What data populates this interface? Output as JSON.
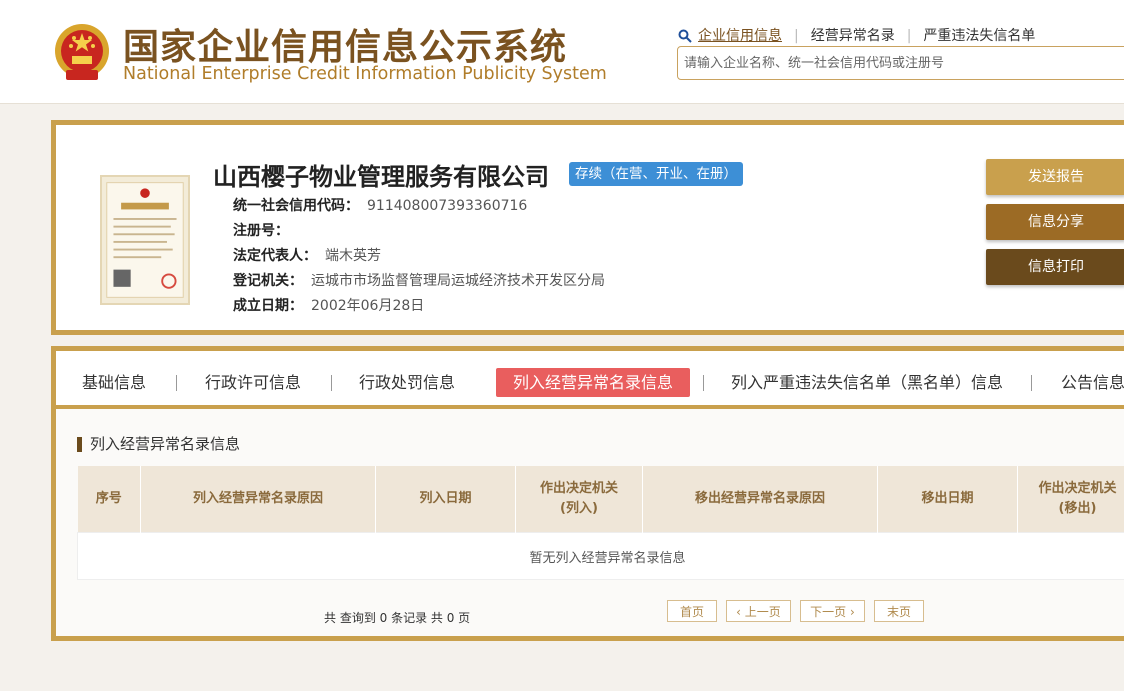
{
  "header": {
    "title_cn": "国家企业信用信息公示系统",
    "title_en": "National Enterprise Credit Information Publicity System",
    "nav": [
      {
        "label": "企业信用信息"
      },
      {
        "label": "经营异常名录"
      },
      {
        "label": "严重违法失信名单"
      }
    ],
    "search": {
      "placeholder": "请输入企业名称、统一社会信用代码或注册号",
      "value": ""
    }
  },
  "company": {
    "name": "山西樱子物业管理服务有限公司",
    "status": "存续（在营、开业、在册）",
    "fields": [
      {
        "label": "统一社会信用代码：",
        "value": "911408007393360716"
      },
      {
        "label": "注册号：",
        "value": ""
      },
      {
        "label": "法定代表人：",
        "value": "端木英芳"
      },
      {
        "label": "登记机关：",
        "value": "运城市市场监督管理局运城经济技术开发区分局"
      },
      {
        "label": "成立日期：",
        "value": "2002年06月28日"
      }
    ],
    "actions": {
      "report": "发送报告",
      "share": "信息分享",
      "print": "信息打印"
    }
  },
  "tabs": [
    {
      "label": "基础信息"
    },
    {
      "label": "行政许可信息"
    },
    {
      "label": "行政处罚信息"
    },
    {
      "label": "列入经营异常名录信息",
      "active": true
    },
    {
      "label": "列入严重违法失信名单（黑名单）信息"
    },
    {
      "label": "公告信息"
    }
  ],
  "section": {
    "title": "列入经营异常名录信息",
    "columns": [
      [
        "序号"
      ],
      [
        "列入经营异常名录原因"
      ],
      [
        "列入日期"
      ],
      [
        "作出决定机关",
        "(列入)"
      ],
      [
        "移出经营异常名录原因"
      ],
      [
        "移出日期"
      ],
      [
        "作出决定机关",
        "(移出)"
      ]
    ],
    "empty_text": "暂无列入经营异常名录信息"
  },
  "pagination": {
    "summary": "共 查询到 0 条记录 共 0 页",
    "first": "首页",
    "prev": "上一页",
    "next": "下一页",
    "last": "末页"
  },
  "colors": {
    "accent": "#c9a04d",
    "active_tab": "#e95e5e",
    "status_badge": "#3d8fd6"
  }
}
